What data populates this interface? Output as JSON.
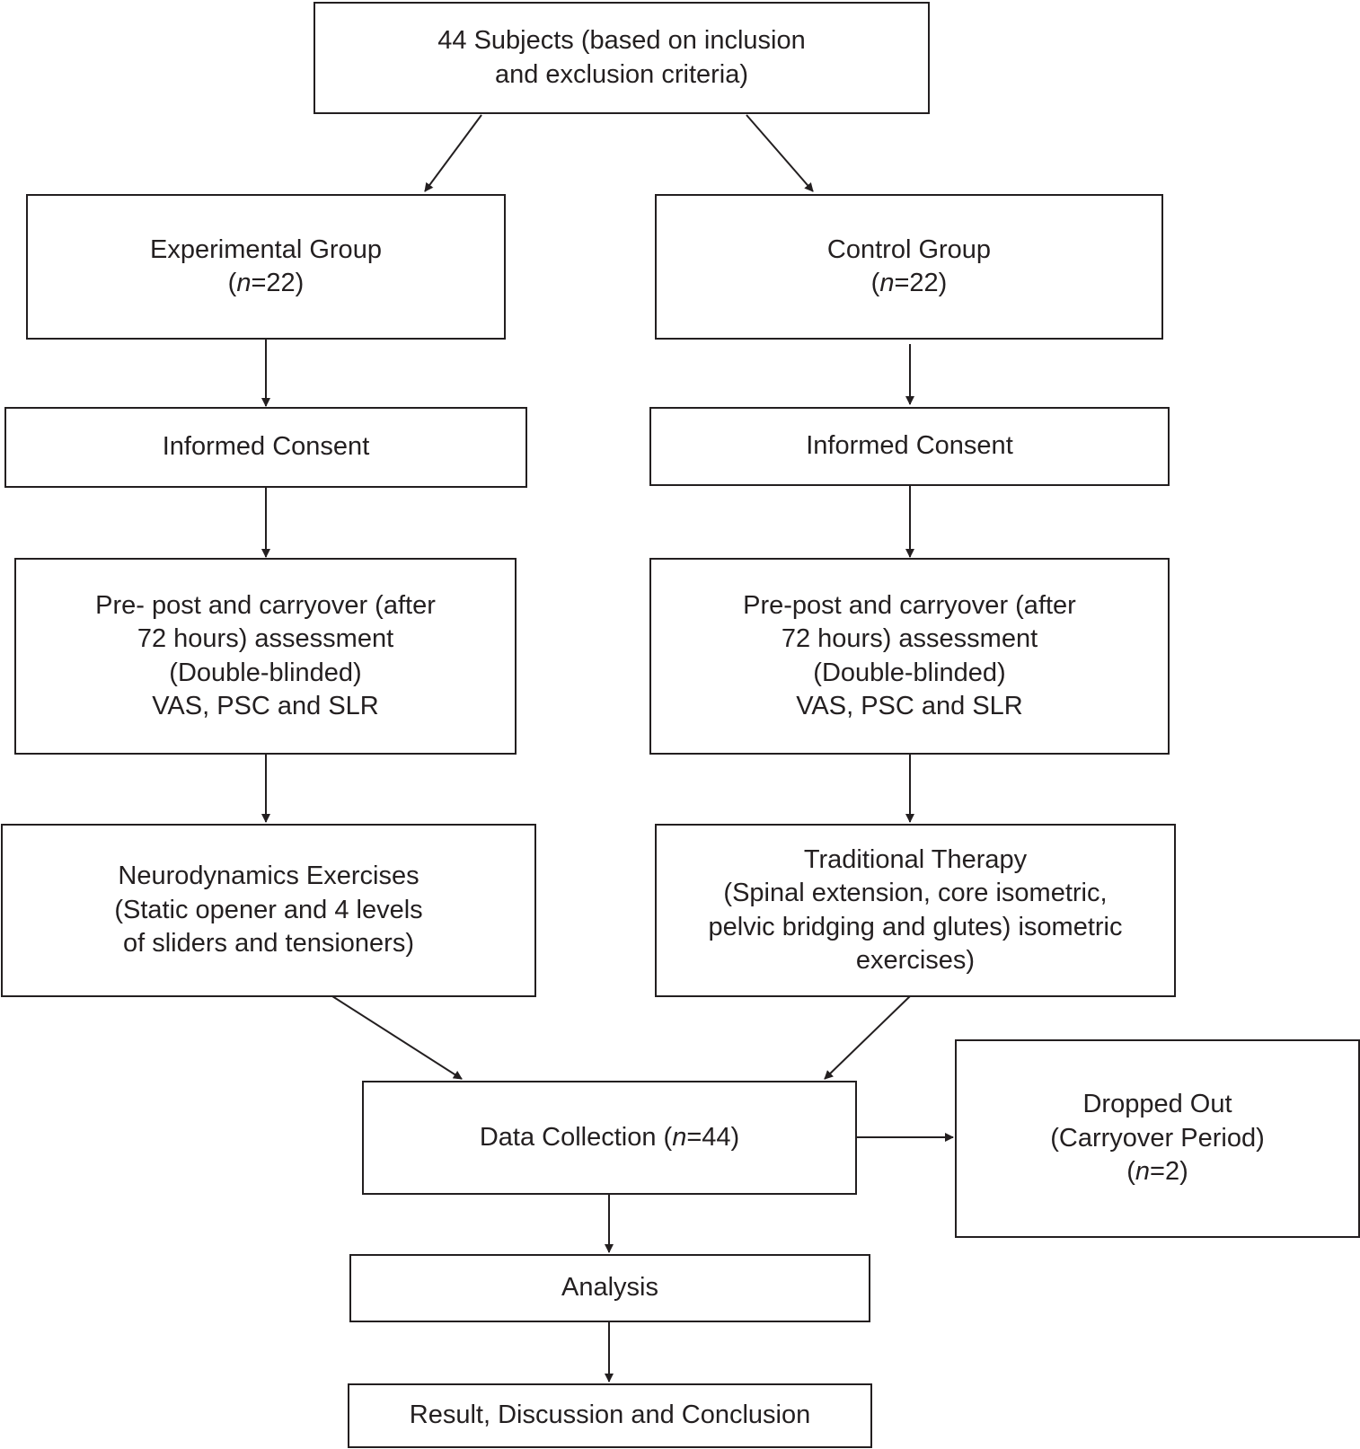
{
  "colors": {
    "stroke": "#231f20",
    "background": "#ffffff"
  },
  "boxes": {
    "subjects": {
      "line1": "44 Subjects (based on inclusion",
      "line2": "and exclusion criteria)"
    },
    "experimental_group": {
      "line1": "Experimental Group",
      "n_pre": "(",
      "n_var": "n",
      "n_post": "=22)"
    },
    "control_group": {
      "line1": "Control Group",
      "n_pre": "(",
      "n_var": "n",
      "n_post": "=22)"
    },
    "consent_left": {
      "line1": "Informed Consent"
    },
    "consent_right": {
      "line1": "Informed Consent"
    },
    "assessment_left": {
      "line1": "Pre- post and carryover (after",
      "line2": "72 hours) assessment",
      "line3": "(Double-blinded)",
      "line4": "VAS, PSC and SLR"
    },
    "assessment_right": {
      "line1": "Pre-post and carryover (after",
      "line2": "72 hours) assessment",
      "line3": "(Double-blinded)",
      "line4": "VAS, PSC and SLR"
    },
    "neurodynamics": {
      "line1": "Neurodynamics Exercises",
      "line2": "(Static opener and 4 levels",
      "line3": "of sliders and tensioners)"
    },
    "traditional": {
      "line1": "Traditional Therapy",
      "line2": "(Spinal extension, core isometric,",
      "line3": "pelvic bridging and glutes) isometric",
      "line4": "exercises)"
    },
    "data_collection": {
      "pre": "Data Collection (",
      "n_var": "n",
      "post": "=44)"
    },
    "dropped_out": {
      "line1": "Dropped Out",
      "line2": "(Carryover Period)",
      "n_pre": "(",
      "n_var": "n",
      "n_post": "=2)"
    },
    "analysis": {
      "line1": "Analysis"
    },
    "result": {
      "line1": "Result, Discussion and Conclusion"
    }
  }
}
